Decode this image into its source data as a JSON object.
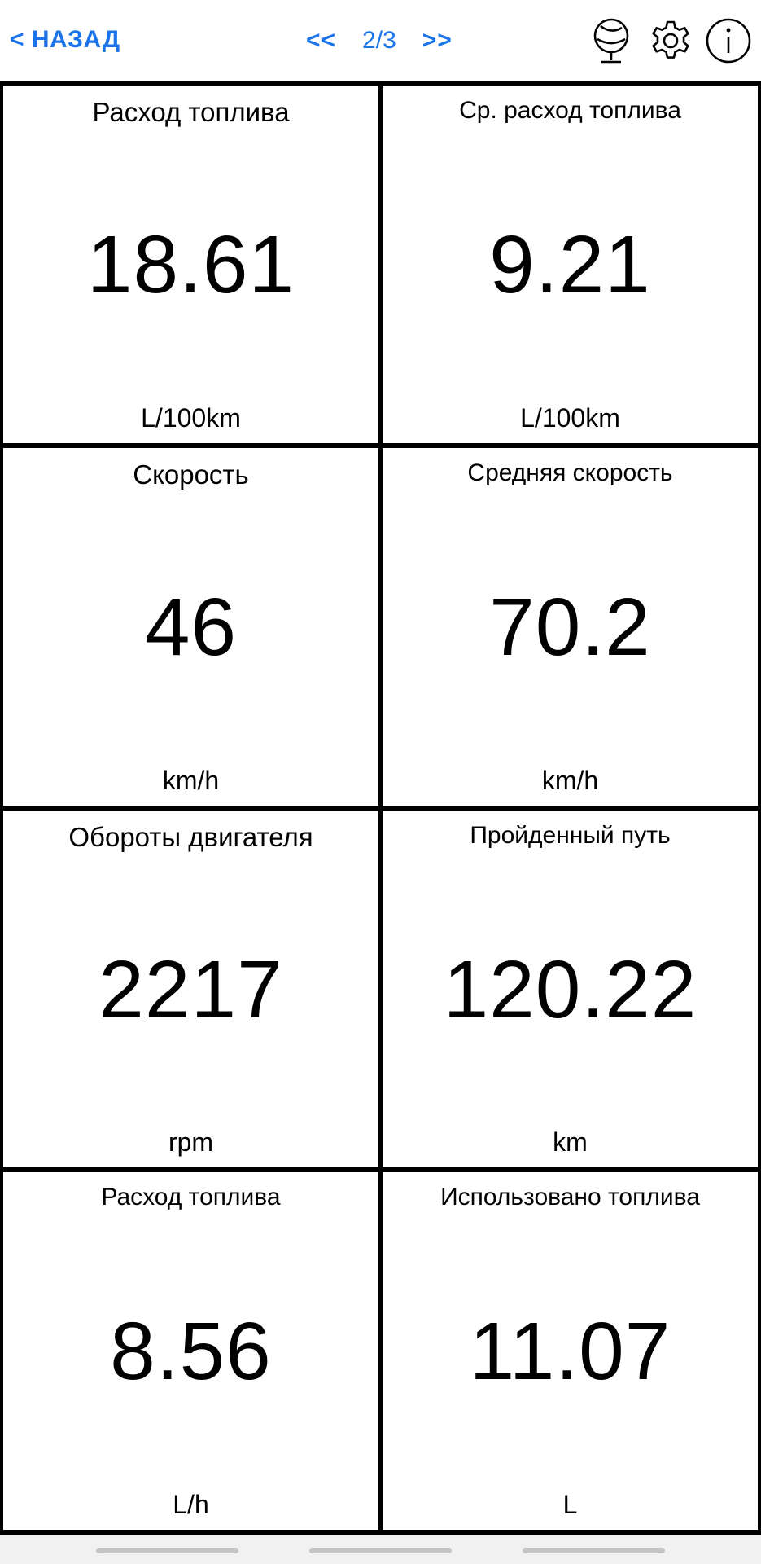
{
  "header": {
    "back_label": "< НАЗАД",
    "prev_label": "<<",
    "page_indicator": "2/3",
    "next_label": ">>",
    "accent_color": "#1a73e8",
    "icons": [
      "globe-icon",
      "gear-icon",
      "info-icon"
    ]
  },
  "tiles": [
    {
      "title": "Расход топлива",
      "value": "18.61",
      "unit": "L/100km"
    },
    {
      "title": "Ср. расход топлива",
      "value": "9.21",
      "unit": "L/100km"
    },
    {
      "title": "Скорость",
      "value": "46",
      "unit": "km/h"
    },
    {
      "title": "Средняя скорость",
      "value": "70.2",
      "unit": "km/h"
    },
    {
      "title": "Обороты двигателя",
      "value": "2217",
      "unit": "rpm"
    },
    {
      "title": "Пройденный путь",
      "value": "120.22",
      "unit": "km"
    },
    {
      "title": "Расход топлива",
      "value": "8.56",
      "unit": "L/h"
    },
    {
      "title": "Использовано топлива",
      "value": "11.07",
      "unit": "L"
    }
  ]
}
